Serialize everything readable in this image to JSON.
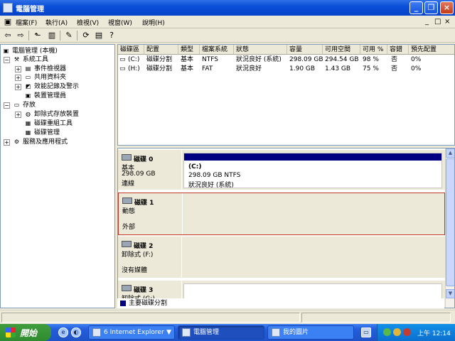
{
  "window": {
    "title": "電腦管理"
  },
  "menu": [
    "檔案(F)",
    "執行(A)",
    "檢視(V)",
    "視窗(W)",
    "說明(H)"
  ],
  "mdi": [
    "_",
    "□",
    "×"
  ],
  "tree": {
    "root": "電腦管理 (本機)",
    "system_tools": "系統工具",
    "event_viewer": "事件檢視器",
    "shared_folders": "共用資料夾",
    "perf_logs": "效能記錄及警示",
    "device_manager": "裝置管理員",
    "storage": "存放",
    "removable_storage": "卸除式存放裝置",
    "defrag": "磁碟重組工具",
    "disk_mgmt": "磁碟管理",
    "services": "服務及應用程式"
  },
  "columns": [
    "磁碟區",
    "配置",
    "類型",
    "檔案系統",
    "狀態",
    "容量",
    "可用空間",
    "可用 %",
    "容錯",
    "預先配置"
  ],
  "volumes": [
    [
      "(C:)",
      "磁碟分割",
      "基本",
      "NTFS",
      "狀況良好 (系統)",
      "298.09 GB",
      "294.54 GB",
      "98 %",
      "否",
      "0%"
    ],
    [
      "(H:)",
      "磁碟分割",
      "基本",
      "FAT",
      "狀況良好",
      "1.90 GB",
      "1.43 GB",
      "75 %",
      "否",
      "0%"
    ]
  ],
  "disks": {
    "d0": {
      "name": "磁碟 0",
      "type": "基本",
      "size": "298.09 GB",
      "status": "連線",
      "vol_name": "(C:)",
      "vol_size": "298.09 GB NTFS",
      "vol_status": "狀況良好 (系統)"
    },
    "d1": {
      "name": "磁碟 1",
      "type": "動態",
      "status": "外部"
    },
    "d2": {
      "name": "磁碟 2",
      "type": "卸除式 (F:)",
      "status": "沒有媒體"
    },
    "d3": {
      "name": "磁碟 3",
      "type": "卸除式 (G:)"
    }
  },
  "legend": "主要磁碟分割",
  "taskbar": {
    "start": "開始",
    "tasks": [
      "6 Internet Explorer",
      "電腦管理",
      "我的圖片"
    ],
    "clock": "上午 12:14"
  },
  "colors": {
    "title": "#0A4FD8",
    "primary_partition": "#000080",
    "selected_border": "#C0392B"
  }
}
